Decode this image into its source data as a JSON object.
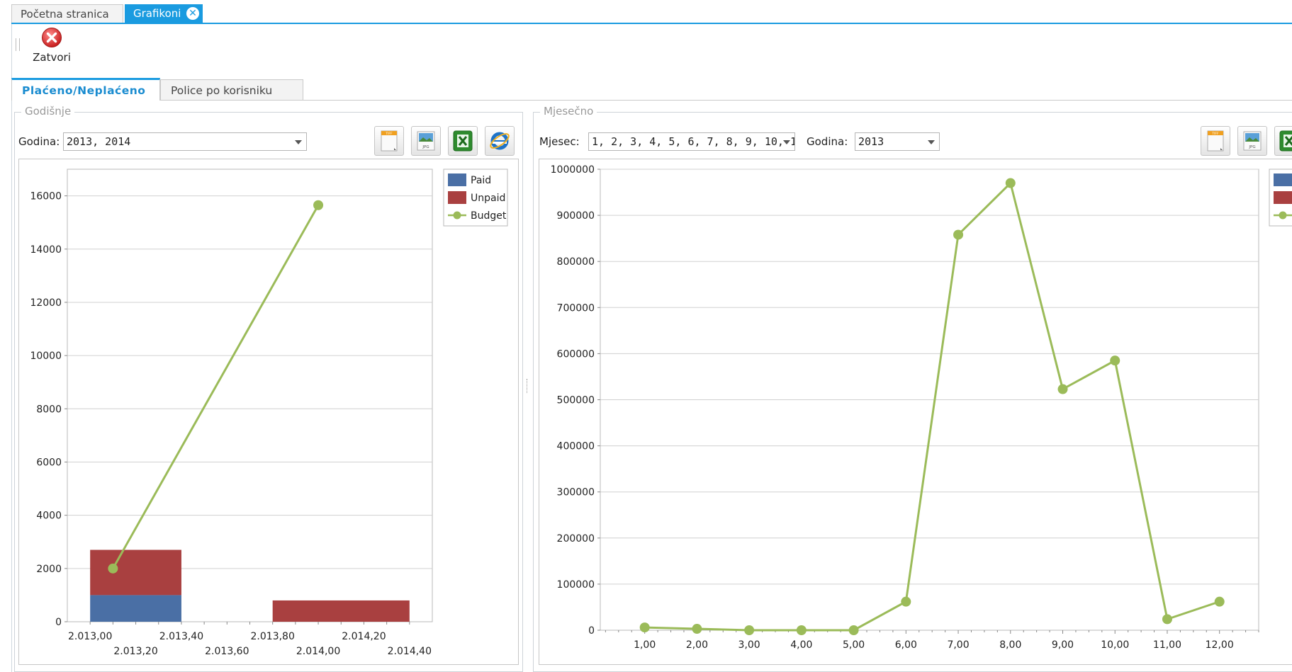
{
  "doc_tabs": [
    {
      "label": "Početna stranica",
      "active": false
    },
    {
      "label": "Grafikoni",
      "active": true
    }
  ],
  "toolbar": {
    "close_label": "Zatvori"
  },
  "sub_tabs": [
    {
      "label": "Plaćeno/Neplaćeno",
      "active": true
    },
    {
      "label": "Police po korisniku",
      "active": false
    }
  ],
  "yearly": {
    "legend": "Godišnje",
    "year_label": "Godina:",
    "year_value": "2013, 2014"
  },
  "monthly": {
    "legend": "Mjesečno",
    "month_label": "Mjesec:",
    "month_value": "1, 2, 3, 4, 5, 6, 7, 8, 9, 10, 11,...",
    "year_label": "Godina:",
    "year_value": "2013"
  },
  "export_icons": [
    "tiff-export-icon",
    "jpg-export-icon",
    "excel-export-icon",
    "internet-explorer-icon"
  ],
  "colors": {
    "accent": "#1a9be0",
    "paid": "#4a6fa5",
    "unpaid": "#a94040",
    "budget": "#9bbb59"
  },
  "chart_data": [
    {
      "type": "bar",
      "stacked": true,
      "legend": [
        "Paid",
        "Unpaid",
        "Budget"
      ],
      "legend_position": "top-right",
      "xlim": [
        2012.9,
        2014.5
      ],
      "ylim": [
        0,
        17000
      ],
      "x_ticks_row1": [
        "2.013,00",
        "2.013,40",
        "2.013,80",
        "2.014,20"
      ],
      "x_ticks_row1_values": [
        2013.0,
        2013.4,
        2013.8,
        2014.2
      ],
      "x_ticks_row2": [
        "2.013,20",
        "2.013,60",
        "2.014,00",
        "2.014,40"
      ],
      "x_ticks_row2_values": [
        2013.2,
        2013.6,
        2014.0,
        2014.4
      ],
      "y_ticks": [
        0,
        2000,
        4000,
        6000,
        8000,
        10000,
        12000,
        14000,
        16000
      ],
      "bars": [
        {
          "x_start": 2013.0,
          "x_end": 2013.4,
          "paid": 1000,
          "unpaid": 1700
        },
        {
          "x_start": 2013.8,
          "x_end": 2014.4,
          "paid": 0,
          "unpaid": 800
        }
      ],
      "series": [
        {
          "name": "Budget",
          "type": "line",
          "x": [
            2013.1,
            2014.0
          ],
          "values": [
            2000,
            15650
          ]
        }
      ],
      "grid": true
    },
    {
      "type": "line",
      "legend_visible": "partially",
      "xlim": [
        0.15,
        12.75
      ],
      "ylim": [
        0,
        1000000
      ],
      "x_ticks": [
        "1,00",
        "2,00",
        "3,00",
        "4,00",
        "5,00",
        "6,00",
        "7,00",
        "8,00",
        "9,00",
        "10,00",
        "11,00",
        "12,00"
      ],
      "y_ticks": [
        "0",
        "100000",
        "200000",
        "300000",
        "400000",
        "500000",
        "600000",
        "700000",
        "800000",
        "900000",
        "1000000"
      ],
      "y_tick_values": [
        0,
        100000,
        200000,
        300000,
        400000,
        500000,
        600000,
        700000,
        800000,
        900000,
        1000000
      ],
      "series": [
        {
          "name": "Budget",
          "x": [
            1,
            2,
            3,
            4,
            5,
            6,
            7,
            8,
            9,
            10,
            11,
            12
          ],
          "values": [
            6000,
            3000,
            0,
            0,
            0,
            62000,
            858000,
            970000,
            523000,
            585000,
            24000,
            62000
          ]
        }
      ],
      "grid": true
    }
  ]
}
